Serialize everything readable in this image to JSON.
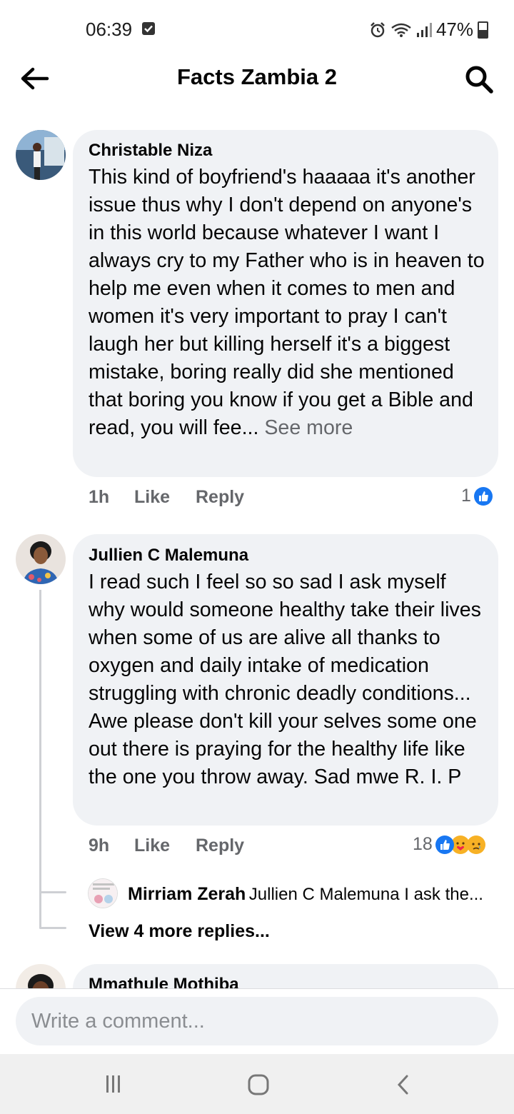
{
  "status_bar": {
    "time": "06:39",
    "battery": "47%"
  },
  "header": {
    "title": "Facts Zambia 2",
    "back_icon": "arrow-left-icon",
    "search_icon": "search-icon"
  },
  "comments": [
    {
      "name": "Christable Niza",
      "text": "This kind of boyfriend's haaaaa it's another issue thus why I don't depend on anyone's in this world because whatever I want I always cry to my Father who is in heaven to help me even when it comes to men and women it's very important to pray I can't laugh her but killing herself it's a biggest mistake, boring really did she mentioned that boring you know if you get a Bible and read, you will fee...",
      "see_more": "See more",
      "time": "1h",
      "like": "Like",
      "reply": "Reply",
      "reaction_count": "1"
    },
    {
      "name": "Jullien C Malemuna",
      "text": "I read such I feel so so sad I ask myself why would someone healthy take their lives when some of us are alive all thanks to oxygen and daily intake of medication struggling with chronic deadly conditions... Awe please don't kill your selves some one out there is praying for the healthy life like the one you throw away. Sad mwe R. I. P",
      "time": "9h",
      "like": "Like",
      "reply": "Reply",
      "reaction_count": "18",
      "reply_preview": {
        "name": "Mirriam Zerah",
        "text": "Jullien C Malemuna I ask the..."
      },
      "view_more_replies": "View 4 more replies..."
    },
    {
      "name": "Mmathule Mothiba"
    }
  ],
  "composer": {
    "placeholder": "Write a comment..."
  },
  "colors": {
    "bubble": "#f0f2f5",
    "meta_text": "#65676b",
    "like_blue": "#1877f2"
  }
}
